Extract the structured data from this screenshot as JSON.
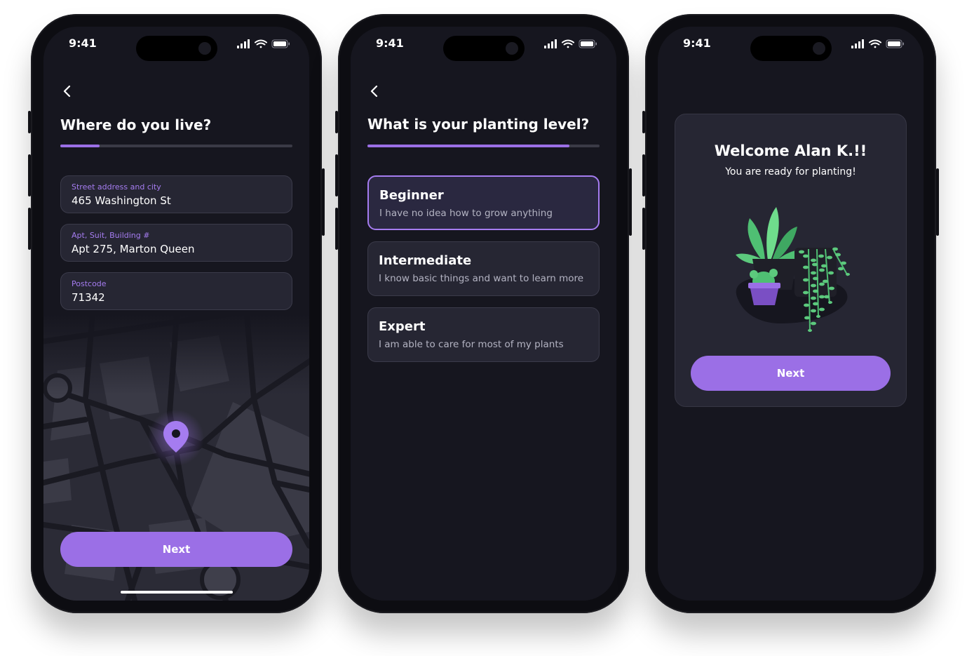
{
  "status": {
    "time": "9:41"
  },
  "screens": [
    {
      "title": "Where do you live?",
      "progress": 0.17,
      "fields": [
        {
          "label": "Street address and city",
          "value": "465 Washington St"
        },
        {
          "label": "Apt, Suit, Building #",
          "value": "Apt 275, Marton Queen"
        },
        {
          "label": "Postcode",
          "value": "71342"
        }
      ],
      "next_label": "Next"
    },
    {
      "title": "What is your planting level?",
      "progress": 0.87,
      "options": [
        {
          "title": "Beginner",
          "description": "I have no idea how to grow anything",
          "selected": true
        },
        {
          "title": "Intermediate",
          "description": "I know basic things and want to learn more",
          "selected": false
        },
        {
          "title": "Expert",
          "description": "I am able to care for most of my plants",
          "selected": false
        }
      ]
    },
    {
      "welcome_title": "Welcome Alan K.!!",
      "welcome_subtitle": "You are ready for planting!",
      "next_label": "Next"
    }
  ],
  "colors": {
    "accent": "#9b6fe6",
    "background": "#16161f",
    "surface": "#262633",
    "plant_green": "#4fbf73"
  }
}
